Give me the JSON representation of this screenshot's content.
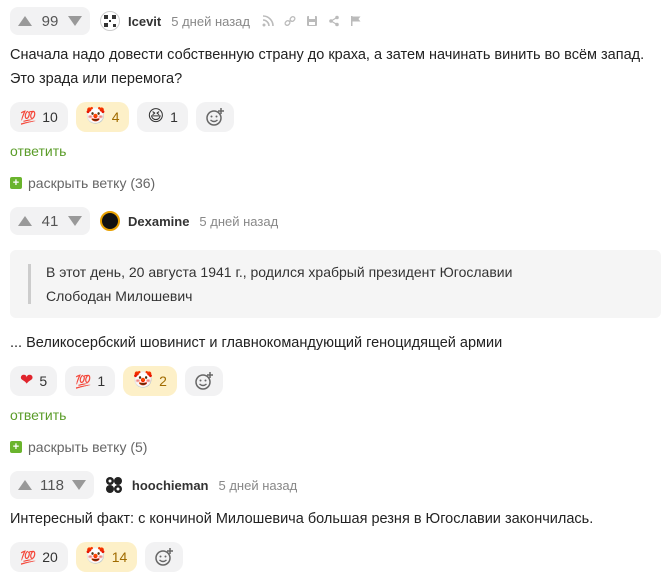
{
  "comments": [
    {
      "score": "99",
      "username": "Icevit",
      "time": "5 дней назад",
      "text": "Сначала надо довести собственную страну до краха, а затем начинать винить во всём запад. Это зрада или перемога?",
      "reactions": [
        {
          "icon": "hundred-icon",
          "emoji": "💯",
          "count": "10",
          "active": false
        },
        {
          "icon": "clown-icon",
          "emoji": "🤡",
          "count": "4",
          "active": true
        },
        {
          "icon": "laughing-face-icon",
          "emoji": "😆",
          "count": "1",
          "active": false
        }
      ],
      "reply_label": "ответить",
      "expand_label": "раскрыть ветку (36)"
    },
    {
      "score": "41",
      "username": "Dexamine",
      "time": "5 дней назад",
      "quote_lines": [
        "В этот день, 20 августа 1941 г., родился храбрый президент Югославии",
        "Слободан Милошевич"
      ],
      "text": "... Великосербский шовинист и главнокомандующий геноцидящей армии",
      "reactions": [
        {
          "icon": "heart-icon",
          "emoji": "❤",
          "count": "5",
          "active": false
        },
        {
          "icon": "hundred-icon",
          "emoji": "💯",
          "count": "1",
          "active": false
        },
        {
          "icon": "clown-icon",
          "emoji": "🤡",
          "count": "2",
          "active": true
        }
      ],
      "reply_label": "ответить",
      "expand_label": "раскрыть ветку (5)"
    },
    {
      "score": "118",
      "username": "hoochieman",
      "time": "5 дней назад",
      "text": "Интересный факт: с кончиной Милошевича большая резня в Югославии закончилась.",
      "reactions": [
        {
          "icon": "hundred-icon",
          "emoji": "💯",
          "count": "20",
          "active": false
        },
        {
          "icon": "clown-icon",
          "emoji": "🤡",
          "count": "14",
          "active": true
        }
      ]
    }
  ],
  "colors": {
    "reply": "#5a9c28",
    "active_reaction_bg": "#fdf0c8",
    "expand_plus": "#6ab42d"
  }
}
